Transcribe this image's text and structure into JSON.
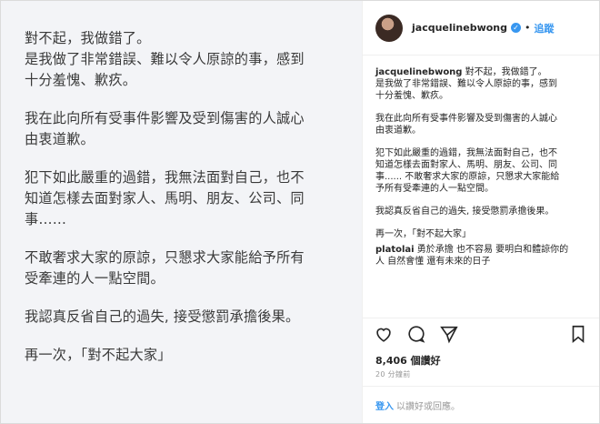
{
  "post_image": {
    "paragraphs": [
      "對不起，我做錯了。\n是我做了非常錯誤、難以令人原諒的事，感到\n十分羞愧、歉疚。",
      "我在此向所有受事件影響及受到傷害的人誠心\n由衷道歉。",
      "犯下如此嚴重的過錯，我無法面對自己，也不\n知道怎樣去面對家人、馬明、朋友、公司、同\n事……",
      "不敢奢求大家的原諒，只懇求大家能給予所有\n受牽連的人一點空間。",
      "我認真反省自己的過失, 接受懲罰承擔後果。",
      "再一次，「對不起大家」"
    ]
  },
  "header": {
    "username": "jacquelinebwong",
    "separator": "•",
    "follow_label": "追蹤"
  },
  "caption": {
    "username": "jacquelinebwong",
    "first_line": "對不起，我做錯了。\n是我做了非常錯誤、難以令人原諒的事，感到\n十分羞愧、歉疚。",
    "paragraphs": [
      "我在此向所有受事件影響及受到傷害的人誠心\n由衷道歉。",
      "犯下如此嚴重的過錯，我無法面對自己，也不\n知道怎樣去面對家人、馬明、朋友、公司、同\n事...... 不敢奢求大家的原諒，只懇求大家能給\n予所有受牽連的人一點空間。",
      "我認真反省自己的過失, 接受懲罰承擔後果。",
      "再一次，「對不起大家」"
    ]
  },
  "comment": {
    "username": "platolai",
    "text": "勇於承擔 也不容易 要明白和體諒你的\n人 自然會懂 還有未來的日子"
  },
  "stats": {
    "likes": "8,406 個讚好",
    "time": "20 分鐘前"
  },
  "login": {
    "link": "登入",
    "text": "以讚好或回應。"
  },
  "icons": [
    "heart-icon",
    "comment-icon",
    "share-icon",
    "bookmark-icon",
    "verified-icon"
  ],
  "colors": {
    "link_blue": "#3897f0",
    "image_background": "#f3f4f7"
  }
}
